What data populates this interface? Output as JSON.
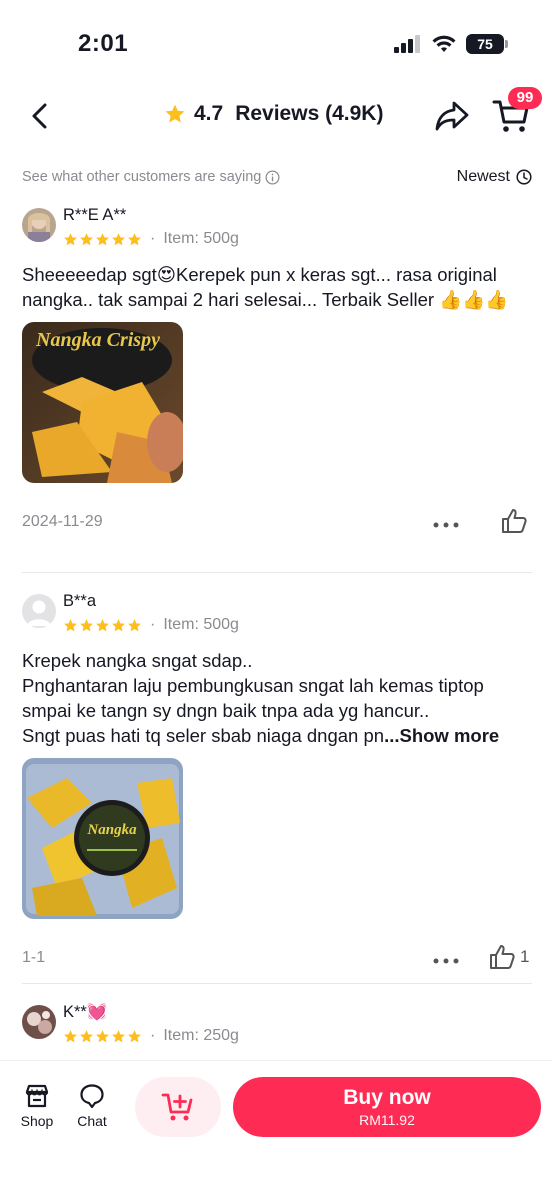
{
  "status_bar": {
    "time": "2:01",
    "battery": "75"
  },
  "header": {
    "rating": "4.7",
    "reviews_label": "Reviews (4.9K)",
    "cart_badge": "99",
    "icons": {
      "back": "chevron-left-icon",
      "share": "share-arrow-icon",
      "cart": "cart-icon",
      "star": "star-icon"
    }
  },
  "subheader": {
    "caption": "See what other customers are saying",
    "sort_label": "Newest"
  },
  "reviews": [
    {
      "name": "R**E A**",
      "rating": 5,
      "item": "Item: 500g",
      "text": "Sheeeeedap sgt😍Kerepek pun x keras sgt... rasa original nangka.. tak sampai 2 hari selesai... Terbaik Seller 👍👍👍",
      "photo_label": "Nangka Crispy",
      "meta": "2024-11-29",
      "likes": ""
    },
    {
      "name": "B**a",
      "rating": 5,
      "item": "Item: 500g",
      "text": "Krepek nangka sngat sdap..\nPnghantaran laju pembungkusan sngat lah kemas tiptop smpai ke tangn sy dngn baik tnpa ada yg hancur..\nSngt puas hati tq seler sbab niaga dngan pn",
      "show_more": "...Show more",
      "photo_label": "Nangka",
      "meta": "1-1",
      "likes": "1"
    },
    {
      "name": "K**💓",
      "rating": 5,
      "item": "Item: 250g"
    }
  ],
  "bottom_bar": {
    "shop_label": "Shop",
    "chat_label": "Chat",
    "buy_label": "Buy now",
    "buy_price": "RM11.92"
  },
  "colors": {
    "accent": "#fe2c55",
    "star": "#fcbf1e",
    "muted": "#8a8b91"
  }
}
